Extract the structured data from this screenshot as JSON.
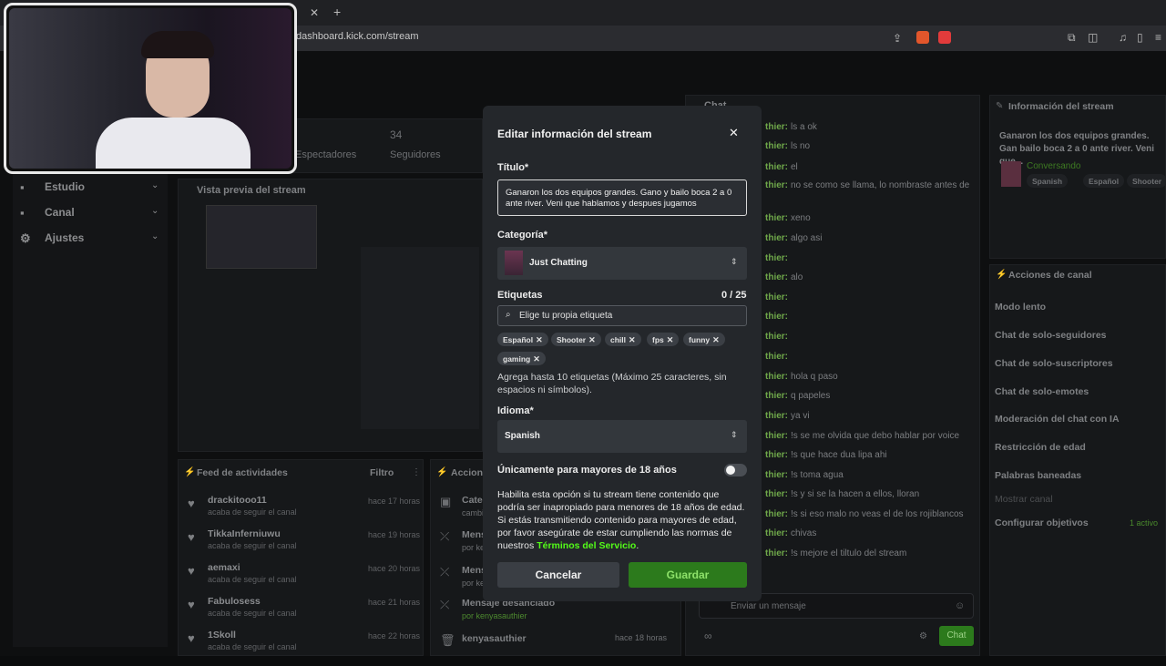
{
  "browser": {
    "url": "dashboard.kick.com/stream",
    "tab_close": "✕",
    "new_tab": "+"
  },
  "sidebar": {
    "items": [
      {
        "label": "Estudio"
      },
      {
        "label": "Canal"
      },
      {
        "label": "Ajustes"
      }
    ]
  },
  "stats": {
    "viewers_label": "Espectadores",
    "followers_value": "34",
    "followers_label": "Seguidores"
  },
  "preview": {
    "title": "Vista previa del stream"
  },
  "feed": {
    "title": "Feed de actividades",
    "filter_label": "Filtro",
    "items": [
      {
        "name": "drackitooo11",
        "sub": "acaba de seguir el canal",
        "time": "hace 17 horas"
      },
      {
        "name": "TikkaInferniuwu",
        "sub": "acaba de seguir el canal",
        "time": "hace 19 horas"
      },
      {
        "name": "aemaxi",
        "sub": "acaba de seguir el canal",
        "time": "hace 20 horas"
      },
      {
        "name": "Fabulosess",
        "sub": "acaba de seguir el canal",
        "time": "hace 21 horas"
      },
      {
        "name": "1Skoll",
        "sub": "acaba de seguir el canal",
        "time": "hace 22 horas"
      }
    ]
  },
  "actions_panel": {
    "title": "Acciones",
    "items": [
      {
        "title": "Cate",
        "sub": "cambi"
      },
      {
        "title": "Mens",
        "sub": "por ke"
      },
      {
        "title": "Mens",
        "sub": "por ke"
      },
      {
        "title": "Mensaje desanclado",
        "sub": "por kenyasauthier"
      },
      {
        "title": "kenyasauthier",
        "sub": "",
        "time": "hace 18 horas"
      }
    ]
  },
  "chat": {
    "title": "Chat",
    "lines": [
      {
        "user": "thier:",
        "text": "ls a ok"
      },
      {
        "user": "thier:",
        "text": "ls no"
      },
      {
        "user": "thier:",
        "text": "el"
      },
      {
        "user": "thier:",
        "text": "no se como se llama, lo nombraste antes de"
      },
      {
        "user": "thier:",
        "text": "xeno"
      },
      {
        "user": "thier:",
        "text": "algo asi"
      },
      {
        "user": "thier:",
        "text": ""
      },
      {
        "user": "thier:",
        "text": "alo"
      },
      {
        "user": "thier:",
        "text": ""
      },
      {
        "user": "thier:",
        "text": ""
      },
      {
        "user": "thier:",
        "text": ""
      },
      {
        "user": "thier:",
        "text": ""
      },
      {
        "user": "thier:",
        "text": "hola q paso"
      },
      {
        "user": "thier:",
        "text": "q papeles"
      },
      {
        "user": "thier:",
        "text": "ya vi"
      },
      {
        "user": "thier:",
        "text": "!s se me olvida que debo hablar por voice"
      },
      {
        "user": "thier:",
        "text": "!s que hace dua lipa ahi"
      },
      {
        "user": "thier:",
        "text": "!s toma agua"
      },
      {
        "user": "thier:",
        "text": "!s y si se la hacen a ellos, lloran"
      },
      {
        "user": "thier:",
        "text": "!s si eso malo no veas el de los rojiblancos"
      },
      {
        "user": "thier:",
        "text": "chivas"
      },
      {
        "user": "thier:",
        "text": "!s mejore el tiltulo del stream"
      }
    ],
    "input_placeholder": "Enviar un mensaje",
    "send_label": "Chat"
  },
  "stream_info": {
    "title": "Información del stream",
    "desc": "Ganaron los dos equipos grandes. Gan bailo boca 2 a 0 ante river. Veni que...",
    "category": "Conversando",
    "tags": [
      "Spanish",
      "Español",
      "Shooter"
    ]
  },
  "channel_actions": {
    "title": "Acciones de canal",
    "items": [
      "Modo lento",
      "Chat de solo-seguidores",
      "Chat de solo-suscriptores",
      "Chat de solo-emotes",
      "Moderación del chat con IA",
      "Restricción de edad",
      "Palabras baneadas",
      "Mostrar canal",
      "Configurar objetivos"
    ],
    "goal_badge": "1 activo"
  },
  "modal": {
    "heading": "Editar información del stream",
    "close": "✕",
    "title_label": "Título*",
    "title_value": "Ganaron los dos equipos grandes. Gano y bailo boca 2 a 0 ante river. Veni que hablamos y despues jugamos",
    "category_label": "Categoría*",
    "category_value": "Just Chatting",
    "tags_label": "Etiquetas",
    "tags_count": "0 / 25",
    "tags_placeholder": "Elige tu propia etiqueta",
    "tags": [
      "Español",
      "Shooter",
      "chill",
      "fps",
      "funny",
      "gaming"
    ],
    "tags_help": "Agrega hasta 10 etiquetas (Máximo 25 caracteres, sin espacios ni símbolos).",
    "language_label": "Idioma*",
    "language_value": "Spanish",
    "adult_label": "Únicamente para mayores de 18 años",
    "adult_on": false,
    "adult_help": "Habilita esta opción si tu stream tiene contenido que podría ser inapropiado para menores de 18 años de edad. Si estás transmitiendo contenido para mayores de edad, por favor asegúrate de estar cumpliendo las normas de nuestros",
    "terms_link": "Términos del Servicio",
    "terms_end": ".",
    "cancel_label": "Cancelar",
    "save_label": "Guardar"
  },
  "colors": {
    "accent": "#53fc18",
    "save_button": "#2c7a1c",
    "modal_bg": "#24272b"
  }
}
